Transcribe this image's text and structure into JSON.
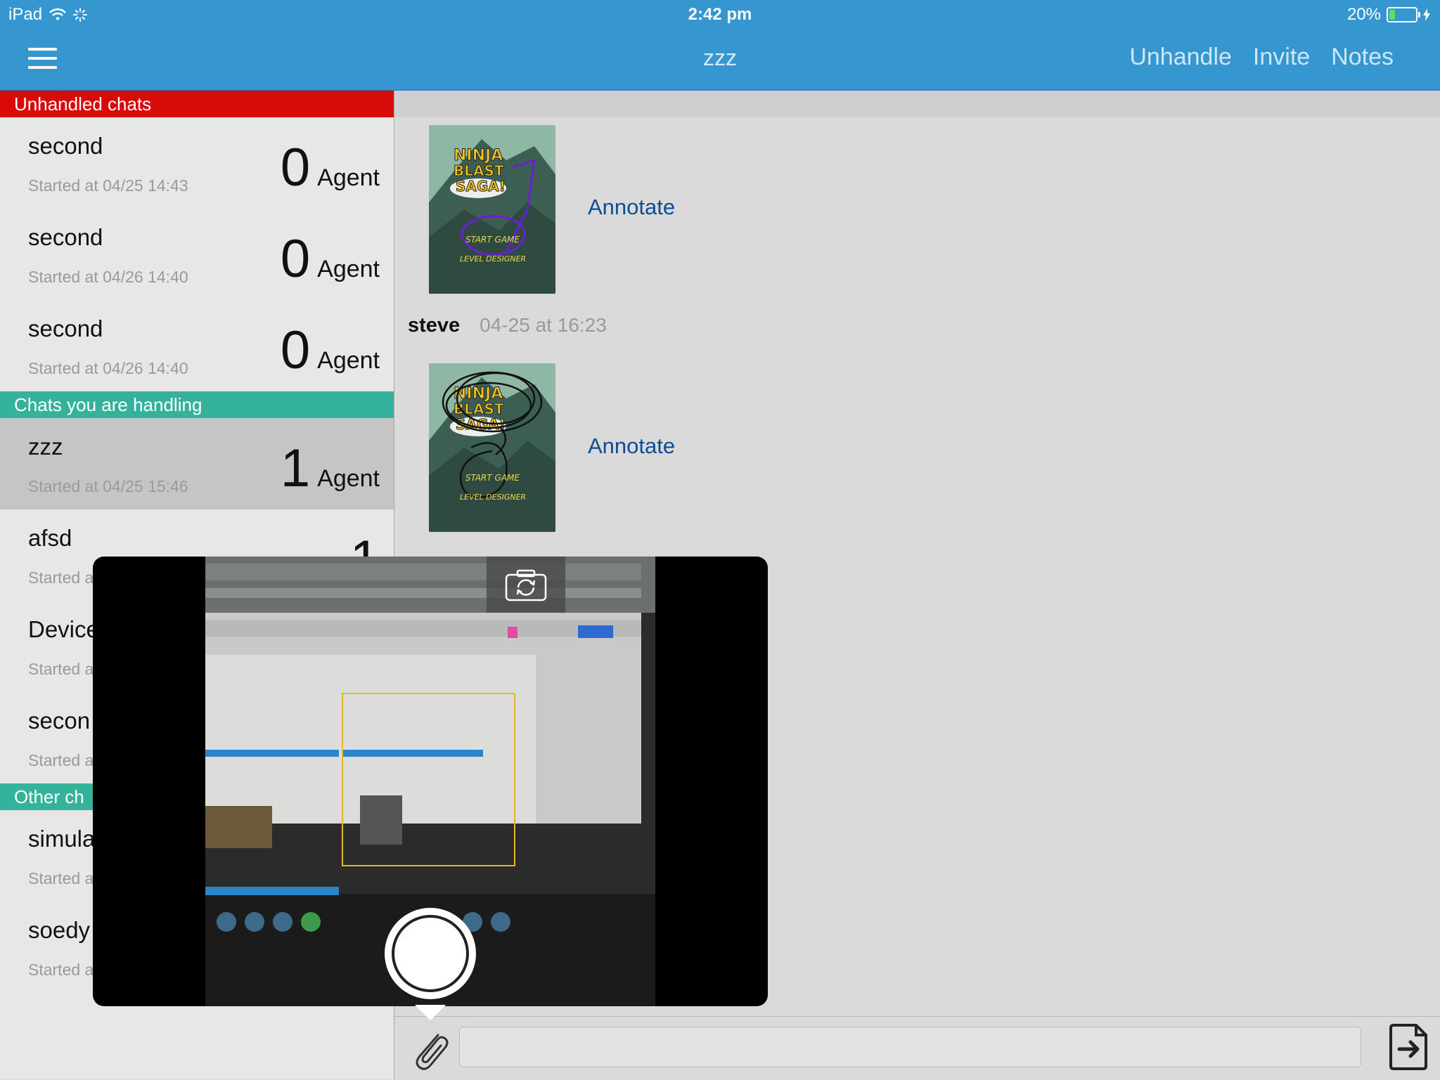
{
  "status_bar": {
    "device": "iPad",
    "time": "2:42 pm",
    "battery": "20%"
  },
  "navbar": {
    "title": "zzz",
    "actions": [
      "Unhandle",
      "Invite",
      "Notes"
    ]
  },
  "sidebar": {
    "sections": [
      {
        "header": "Unhandled chats",
        "color": "#d90a0a",
        "rows": [
          {
            "name": "second",
            "started": "Started at 04/25 14:43",
            "count": "0",
            "label": "Agent"
          },
          {
            "name": "second",
            "started": "Started at 04/26 14:40",
            "count": "0",
            "label": "Agent"
          },
          {
            "name": "second",
            "started": "Started at 04/26 14:40",
            "count": "0",
            "label": "Agent"
          }
        ]
      },
      {
        "header": "Chats you are handling",
        "color": "#34b29c",
        "rows": [
          {
            "name": "zzz",
            "started": "Started at 04/25 15:46",
            "count": "1",
            "label": "Agent",
            "selected": true
          },
          {
            "name": "afsd",
            "started": "Started a",
            "count": "1",
            "label": ""
          },
          {
            "name": "Device",
            "started": "Started a",
            "count": "",
            "label": ""
          },
          {
            "name": "secon",
            "started": "Started a",
            "count": "",
            "label": ""
          }
        ]
      },
      {
        "header": "Other ch",
        "color": "#34b29c",
        "rows": [
          {
            "name": "simula",
            "started": "Started a",
            "count": "",
            "label": ""
          },
          {
            "name": "soedy",
            "started": "Started a",
            "count": "",
            "label": ""
          }
        ]
      }
    ]
  },
  "conversation": {
    "annotate_label": "Annotate",
    "messages": [
      {
        "image_title": [
          "NINJA",
          "BLAST",
          "SAGA!"
        ],
        "menu": [
          "START GAME",
          "LEVEL DESIGNER"
        ]
      },
      {
        "sender": "steve",
        "date": "04-25 at 16:23",
        "image_title": [
          "NINJA",
          "BLAST",
          "SAGA!"
        ],
        "menu": [
          "START GAME",
          "LEVEL DESIGNER"
        ]
      }
    ]
  },
  "composer": {
    "value": "",
    "placeholder": ""
  },
  "colors": {
    "bar": "#3596d0",
    "unhandled": "#d90a0a",
    "handling": "#34b29c",
    "link": "#0d4d94"
  },
  "icons": [
    "menu-icon",
    "wifi-icon",
    "activity-spinner-icon",
    "battery-icon",
    "flip-camera-icon",
    "paperclip-icon",
    "send-icon"
  ]
}
